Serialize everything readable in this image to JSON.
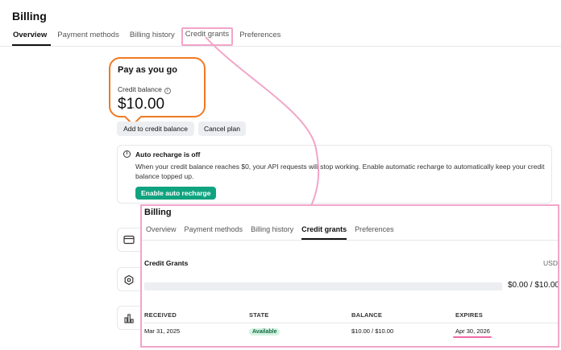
{
  "app": {
    "title": "Billing"
  },
  "tabs": [
    "Overview",
    "Payment methods",
    "Billing history",
    "Credit grants",
    "Preferences"
  ],
  "plan": {
    "title": "Pay as you go",
    "balance_label": "Credit balance",
    "balance_amount": "$10.00",
    "add_label": "Add to credit balance",
    "cancel_label": "Cancel plan"
  },
  "recharge": {
    "title": "Auto recharge is off",
    "description": "When your credit balance reaches $0, your API requests will stop working. Enable automatic recharge to automatically keep your credit balance topped up.",
    "button_label": "Enable auto recharge"
  },
  "side_cards": [
    {
      "icon": "credit-card-icon"
    },
    {
      "icon": "gear-icon"
    },
    {
      "icon": "bar-chart-icon"
    }
  ],
  "inset": {
    "title": "Billing",
    "tabs": [
      "Overview",
      "Payment methods",
      "Billing history",
      "Credit grants",
      "Preferences"
    ],
    "grants_title": "Credit Grants",
    "currency": "USD",
    "usage_text": "$0.00 / $10.00",
    "usage_fraction": 0.0,
    "columns": [
      "RECEIVED",
      "STATE",
      "BALANCE",
      "EXPIRES"
    ],
    "rows": [
      {
        "received": "Mar 31, 2025",
        "state": "Available",
        "balance": "$10.00 / $10.00",
        "expires": "Apr 30, 2026"
      }
    ]
  },
  "colors": {
    "highlight_orange": "#ef7a22",
    "highlight_pink": "#f2a5c8",
    "accent_green": "#10a37f",
    "expires_underline": "#f06aa6"
  }
}
